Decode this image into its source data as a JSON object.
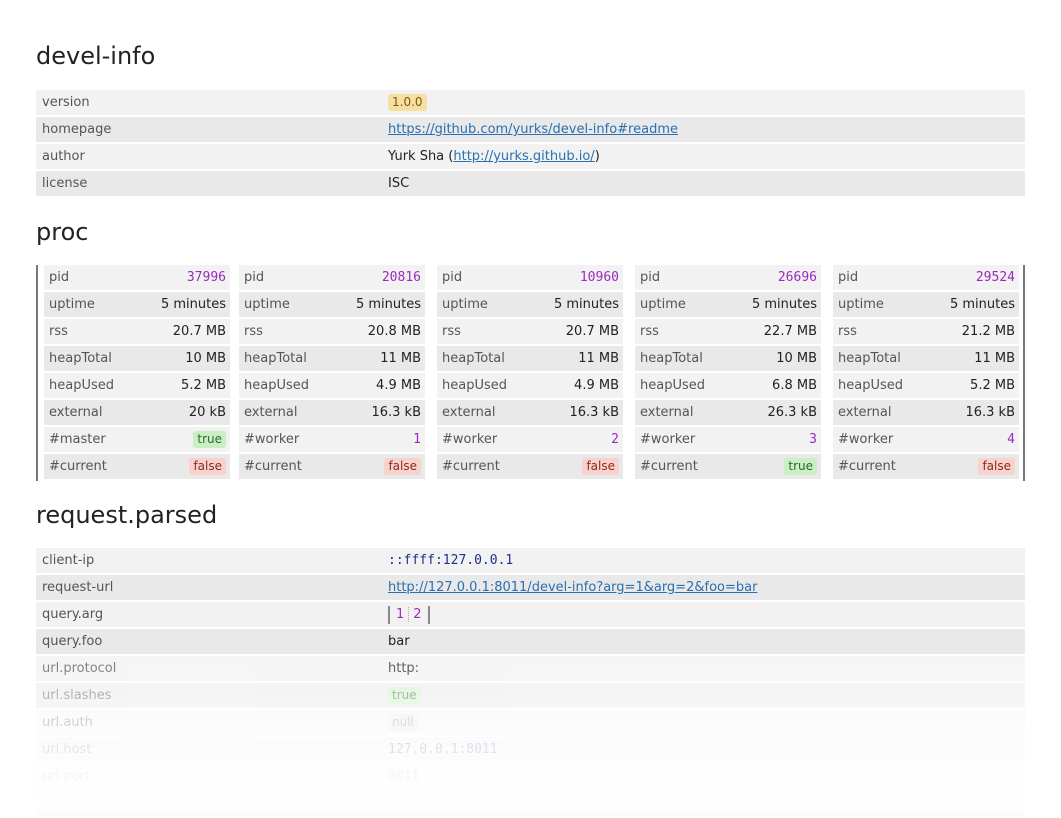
{
  "sections": {
    "devel_info": "devel-info",
    "proc": "proc",
    "request_parsed": "request.parsed"
  },
  "devel_info": {
    "version_key": "version",
    "version": "1.0.0",
    "homepage_key": "homepage",
    "homepage": "https://github.com/yurks/devel-info#readme",
    "author_key": "author",
    "author_name": "Yurk Sha",
    "author_open": " (",
    "author_url": "http://yurks.github.io/",
    "author_close": ")",
    "license_key": "license",
    "license": "ISC"
  },
  "proc": [
    {
      "pid": "37996",
      "uptime": "5 minutes",
      "rss": "20.7 MB",
      "heapTotal": "10 MB",
      "heapUsed": "5.2 MB",
      "external": "20 kB",
      "role_key": "#master",
      "role_val": "true",
      "current": "false"
    },
    {
      "pid": "20816",
      "uptime": "5 minutes",
      "rss": "20.8 MB",
      "heapTotal": "11 MB",
      "heapUsed": "4.9 MB",
      "external": "16.3 kB",
      "role_key": "#worker",
      "role_val": "1",
      "current": "false"
    },
    {
      "pid": "10960",
      "uptime": "5 minutes",
      "rss": "20.7 MB",
      "heapTotal": "11 MB",
      "heapUsed": "4.9 MB",
      "external": "16.3 kB",
      "role_key": "#worker",
      "role_val": "2",
      "current": "false"
    },
    {
      "pid": "26696",
      "uptime": "5 minutes",
      "rss": "22.7 MB",
      "heapTotal": "10 MB",
      "heapUsed": "6.8 MB",
      "external": "26.3 kB",
      "role_key": "#worker",
      "role_val": "3",
      "current": "true"
    },
    {
      "pid": "29524",
      "uptime": "5 minutes",
      "rss": "21.2 MB",
      "heapTotal": "11 MB",
      "heapUsed": "5.2 MB",
      "external": "16.3 kB",
      "role_key": "#worker",
      "role_val": "4",
      "current": "false"
    }
  ],
  "proc_keys": {
    "pid": "pid",
    "uptime": "uptime",
    "rss": "rss",
    "heapTotal": "heapTotal",
    "heapUsed": "heapUsed",
    "external": "external",
    "current": "#current"
  },
  "request": {
    "client_ip_key": "client-ip",
    "client_ip": "::ffff:127.0.0.1",
    "request_url_key": "request-url",
    "request_url": "http://127.0.0.1:8011/devel-info?arg=1&arg=2&foo=bar",
    "query_arg_key": "query.arg",
    "query_arg_values": [
      "1",
      "2"
    ],
    "query_foo_key": "query.foo",
    "query_foo": "bar",
    "url_protocol_key": "url.protocol",
    "url_protocol": "http:",
    "url_slashes_key": "url.slashes",
    "url_slashes": "true",
    "url_auth_key": "url.auth",
    "url_auth": "null",
    "url_host_key": "url.host",
    "url_host": "127.0.0.1:8011",
    "url_port_key": "url.port",
    "url_port": "8011",
    "url_hostname_key": "url.hostname",
    "url_hostname": "127.0.0.1"
  }
}
